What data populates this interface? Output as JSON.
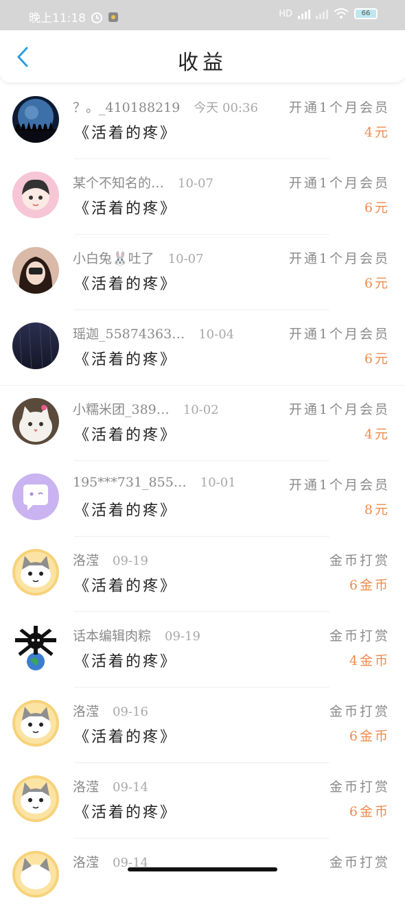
{
  "status_bar": {
    "time": "晚上11:18",
    "network": "HD",
    "battery": "66"
  },
  "header": {
    "title": "收益"
  },
  "book_title": "《活着的疼》",
  "entries": [
    {
      "name": "？。_410188219",
      "date": "今天 00:36",
      "type": "开通1个月会员",
      "amount": "4元",
      "avatar": "earth-night"
    },
    {
      "name": "某个不知名的…",
      "date": "10-07",
      "type": "开通1个月会员",
      "amount": "6元",
      "avatar": "anime-girl"
    },
    {
      "name": "小白兔🐰吐了",
      "date": "10-07",
      "type": "开通1个月会员",
      "amount": "6元",
      "avatar": "photo-girl"
    },
    {
      "name": "瑶迦_55874363…",
      "date": "10-04",
      "type": "开通1个月会员",
      "amount": "6元",
      "avatar": "dark-rain"
    },
    {
      "name": "小糯米团_389…",
      "date": "10-02",
      "type": "开通1个月会员",
      "amount": "4元",
      "avatar": "white-cat"
    },
    {
      "name": "195***731_855…",
      "date": "10-01",
      "type": "开通1个月会员",
      "amount": "8元",
      "avatar": "chat-bubble"
    },
    {
      "name": "洛滢",
      "date": "09-19",
      "type": "金币打赏",
      "amount": "6金币",
      "avatar": "cartoon-cat"
    },
    {
      "name": "话本编辑肉粽",
      "date": "09-19",
      "type": "金币打赏",
      "amount": "4金币",
      "avatar": "skull-earth"
    },
    {
      "name": "洛滢",
      "date": "09-16",
      "type": "金币打赏",
      "amount": "6金币",
      "avatar": "cartoon-cat"
    },
    {
      "name": "洛滢",
      "date": "09-14",
      "type": "金币打赏",
      "amount": "6金币",
      "avatar": "cartoon-cat"
    },
    {
      "name": "洛滢",
      "date": "09-14",
      "type": "金币打赏",
      "amount": "",
      "avatar": "cartoon-cat"
    }
  ],
  "colors": {
    "accent_blue": "#2a9fe0",
    "amount_orange": "#ef8b4d",
    "status_bar_bg": "#d6d6d6"
  }
}
